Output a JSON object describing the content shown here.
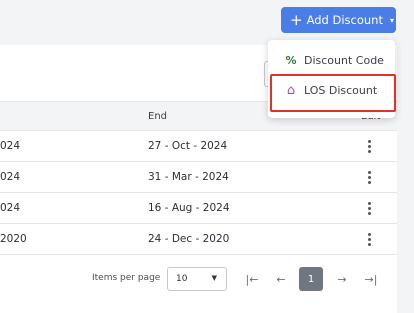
{
  "header": {
    "add_button_label": "Add Discount",
    "plus_glyph": "+",
    "caret_glyph": "▾"
  },
  "table": {
    "columns": {
      "end": "End",
      "edit": "Edit"
    },
    "rows": [
      {
        "start_partial": "024",
        "end": "27 - Oct - 2024"
      },
      {
        "start_partial": "024",
        "end": "31 - Mar - 2024"
      },
      {
        "start_partial": "024",
        "end": "16 - Aug - 2024"
      },
      {
        "start_partial": "2020",
        "end": "24 - Dec - 2020"
      }
    ],
    "row_action_icon": "more-vertical-icon"
  },
  "pagination": {
    "items_per_page_label": "Items per page",
    "items_per_page_value": "10",
    "current_page": "1",
    "first_glyph": "|←",
    "prev_glyph": "←",
    "next_glyph": "→",
    "last_glyph": "→|"
  },
  "dropdown": {
    "items": [
      {
        "label": "Discount Code",
        "icon": "percent-icon",
        "glyph": "%",
        "color": "#2e7d32"
      },
      {
        "label": "LOS Discount",
        "icon": "home-icon",
        "glyph": "⌂",
        "color": "#a349c4"
      }
    ]
  },
  "colors": {
    "accent": "#4a7de6",
    "highlight_border": "#e0312d",
    "active_page": "#707780"
  }
}
